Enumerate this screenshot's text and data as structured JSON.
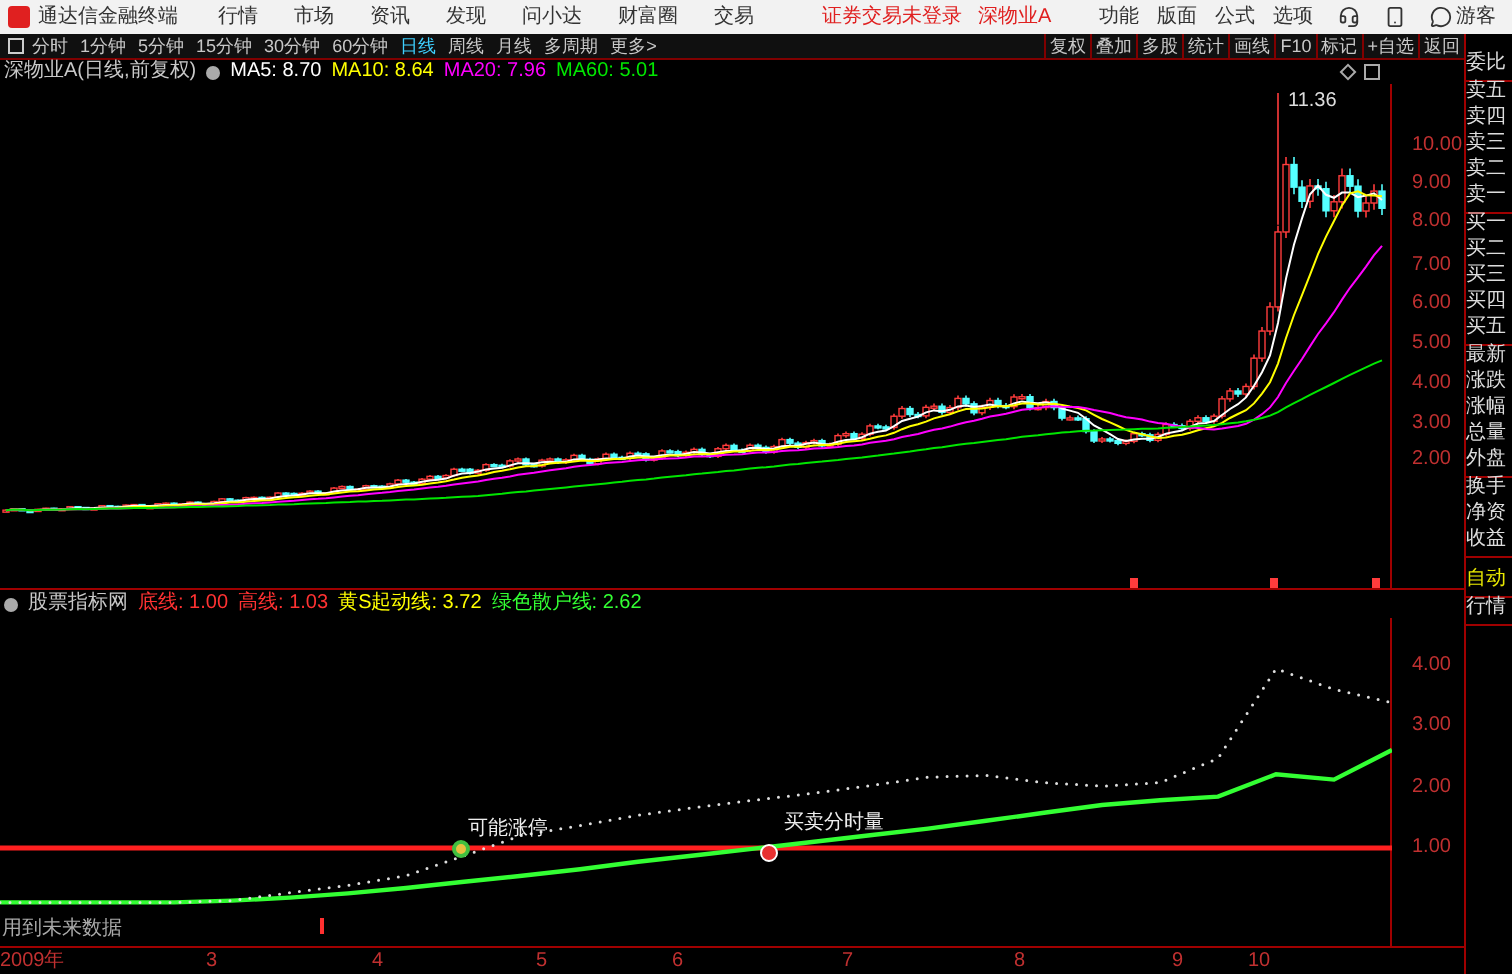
{
  "app": {
    "title": "通达信金融终端"
  },
  "menu": [
    "行情",
    "市场",
    "资讯",
    "发现",
    "问小达",
    "财富圈",
    "交易"
  ],
  "status": [
    "证券交易未登录",
    "深物业A"
  ],
  "right_menu": [
    "功能",
    "版面",
    "公式",
    "选项"
  ],
  "user": "游客",
  "periods": [
    {
      "label": "分时",
      "selected": false
    },
    {
      "label": "1分钟",
      "selected": false
    },
    {
      "label": "5分钟",
      "selected": false
    },
    {
      "label": "15分钟",
      "selected": false
    },
    {
      "label": "30分钟",
      "selected": false
    },
    {
      "label": "60分钟",
      "selected": false
    },
    {
      "label": "日线",
      "selected": true
    },
    {
      "label": "周线",
      "selected": false
    },
    {
      "label": "月线",
      "selected": false
    },
    {
      "label": "多周期",
      "selected": false
    },
    {
      "label": "更多>",
      "selected": false
    }
  ],
  "tools": [
    "复权",
    "叠加",
    "多股",
    "统计",
    "画线",
    "F10",
    "标记",
    "+自选",
    "返回"
  ],
  "info_line": {
    "title": "深物业A(日线,前复权)",
    "items": [
      {
        "text": "MA5: 8.70",
        "color": "#ffffff"
      },
      {
        "text": "MA10: 8.64",
        "color": "#ffff00"
      },
      {
        "text": "MA20: 7.96",
        "color": "#ff00ff"
      },
      {
        "text": "MA60: 5.01",
        "color": "#00e600"
      }
    ]
  },
  "main_chart": {
    "peak_label": "11.36",
    "price_axis": [
      "10.00",
      "9.00",
      "8.00",
      "7.00",
      "6.00",
      "5.00",
      "4.00",
      "3.00",
      "2.00"
    ]
  },
  "indicator": {
    "title": "股票指标网",
    "items": [
      {
        "text": "底线: 1.00",
        "color": "#ff3232"
      },
      {
        "text": "高线: 1.03",
        "color": "#ff3232"
      },
      {
        "text": "黄S起动线: 3.72",
        "color": "#ffff00"
      },
      {
        "text": "绿色散户线: 2.62",
        "color": "#33ff33"
      }
    ],
    "annotations": [
      "可能涨停",
      "买卖分时量"
    ],
    "chart_data": {
      "type": "line",
      "ylim": [
        -0.62,
        4.8
      ],
      "yticks": [
        {
          "value": 4,
          "label": "4.00"
        },
        {
          "value": 3,
          "label": "3.00"
        },
        {
          "value": 2,
          "label": "2.00"
        },
        {
          "value": 1,
          "label": "1.00"
        }
      ],
      "series": [
        {
          "color": "#ff2020",
          "values": [
            1,
            1,
            1,
            1,
            1,
            1,
            1,
            1,
            1,
            1,
            1,
            1,
            1,
            1,
            1,
            1,
            1,
            1,
            1,
            1,
            1,
            1,
            1,
            1,
            1
          ]
        },
        {
          "color": "#33ff33",
          "values": [
            0.1,
            0.1,
            0.1,
            0.1,
            0.13,
            0.18,
            0.25,
            0.34,
            0.44,
            0.54,
            0.65,
            0.77,
            0.88,
            0.99,
            1.1,
            1.21,
            1.32,
            1.45,
            1.58,
            1.71,
            1.79,
            1.85,
            2.22,
            2.13,
            2.62
          ]
        },
        {
          "color": "#dddddd",
          "line_style": "dotted",
          "values": [
            0.1,
            0.1,
            0.1,
            0.1,
            0.13,
            0.26,
            0.38,
            0.54,
            0.87,
            1.21,
            1.37,
            1.54,
            1.67,
            1.79,
            1.9,
            2.03,
            2.17,
            2.2,
            2.08,
            2.02,
            2.08,
            2.48,
            3.96,
            3.62,
            3.4
          ]
        }
      ]
    },
    "note": "用到未来数据"
  },
  "x_axis": [
    "2009年",
    "3",
    "4",
    "5",
    "6",
    "7",
    "8",
    "9",
    "10"
  ],
  "side_panel": {
    "groups": [
      [
        "委比"
      ],
      [
        "卖五",
        "卖四",
        "卖三",
        "卖二",
        "卖一"
      ],
      [
        "买一",
        "买二",
        "买三",
        "买四",
        "买五"
      ],
      [
        "最新",
        "涨跌",
        "涨幅",
        "总量",
        "外盘"
      ],
      [
        "换手",
        "净资",
        "收益"
      ]
    ],
    "modes": [
      {
        "label": "自动",
        "selected": true
      },
      {
        "label": "行情",
        "selected": false
      }
    ]
  }
}
